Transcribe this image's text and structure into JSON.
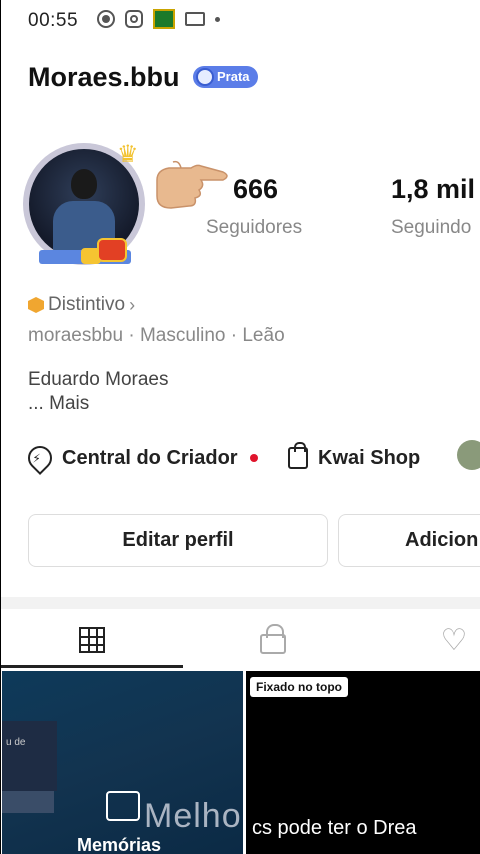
{
  "status_bar": {
    "time": "00:55",
    "icons": [
      "record-icon",
      "instagram-icon",
      "news-app-icon",
      "card-icon",
      "dot-icon"
    ]
  },
  "profile": {
    "username": "Moraes.bbu",
    "badge": "Prata",
    "badge_color": "#5b7de8",
    "stats": [
      {
        "value": "666",
        "label": "Seguidores"
      },
      {
        "value": "1,8 mil",
        "label": "Seguindo"
      }
    ],
    "distintivo": "Distintivo",
    "meta": "moraesbbu · Masculino · Leão",
    "real_name": "Eduardo Moraes",
    "more": "...  Mais"
  },
  "links": {
    "creator_center": "Central do Criador",
    "shop": "Kwai Shop"
  },
  "buttons": {
    "edit_profile": "Editar perfil",
    "add": "Adicion"
  },
  "tabs": [
    "grid-icon",
    "lock-icon",
    "heart-icon"
  ],
  "posts": [
    {
      "panel_text": "u de",
      "overlay_label": "Memórias",
      "background_text": "Melho"
    },
    {
      "pinned_label": "Fixado no topo",
      "caption": "cs pode ter o  Drea"
    }
  ],
  "colors": {
    "accent_red": "#e0142c",
    "tab_active": "#222222"
  }
}
